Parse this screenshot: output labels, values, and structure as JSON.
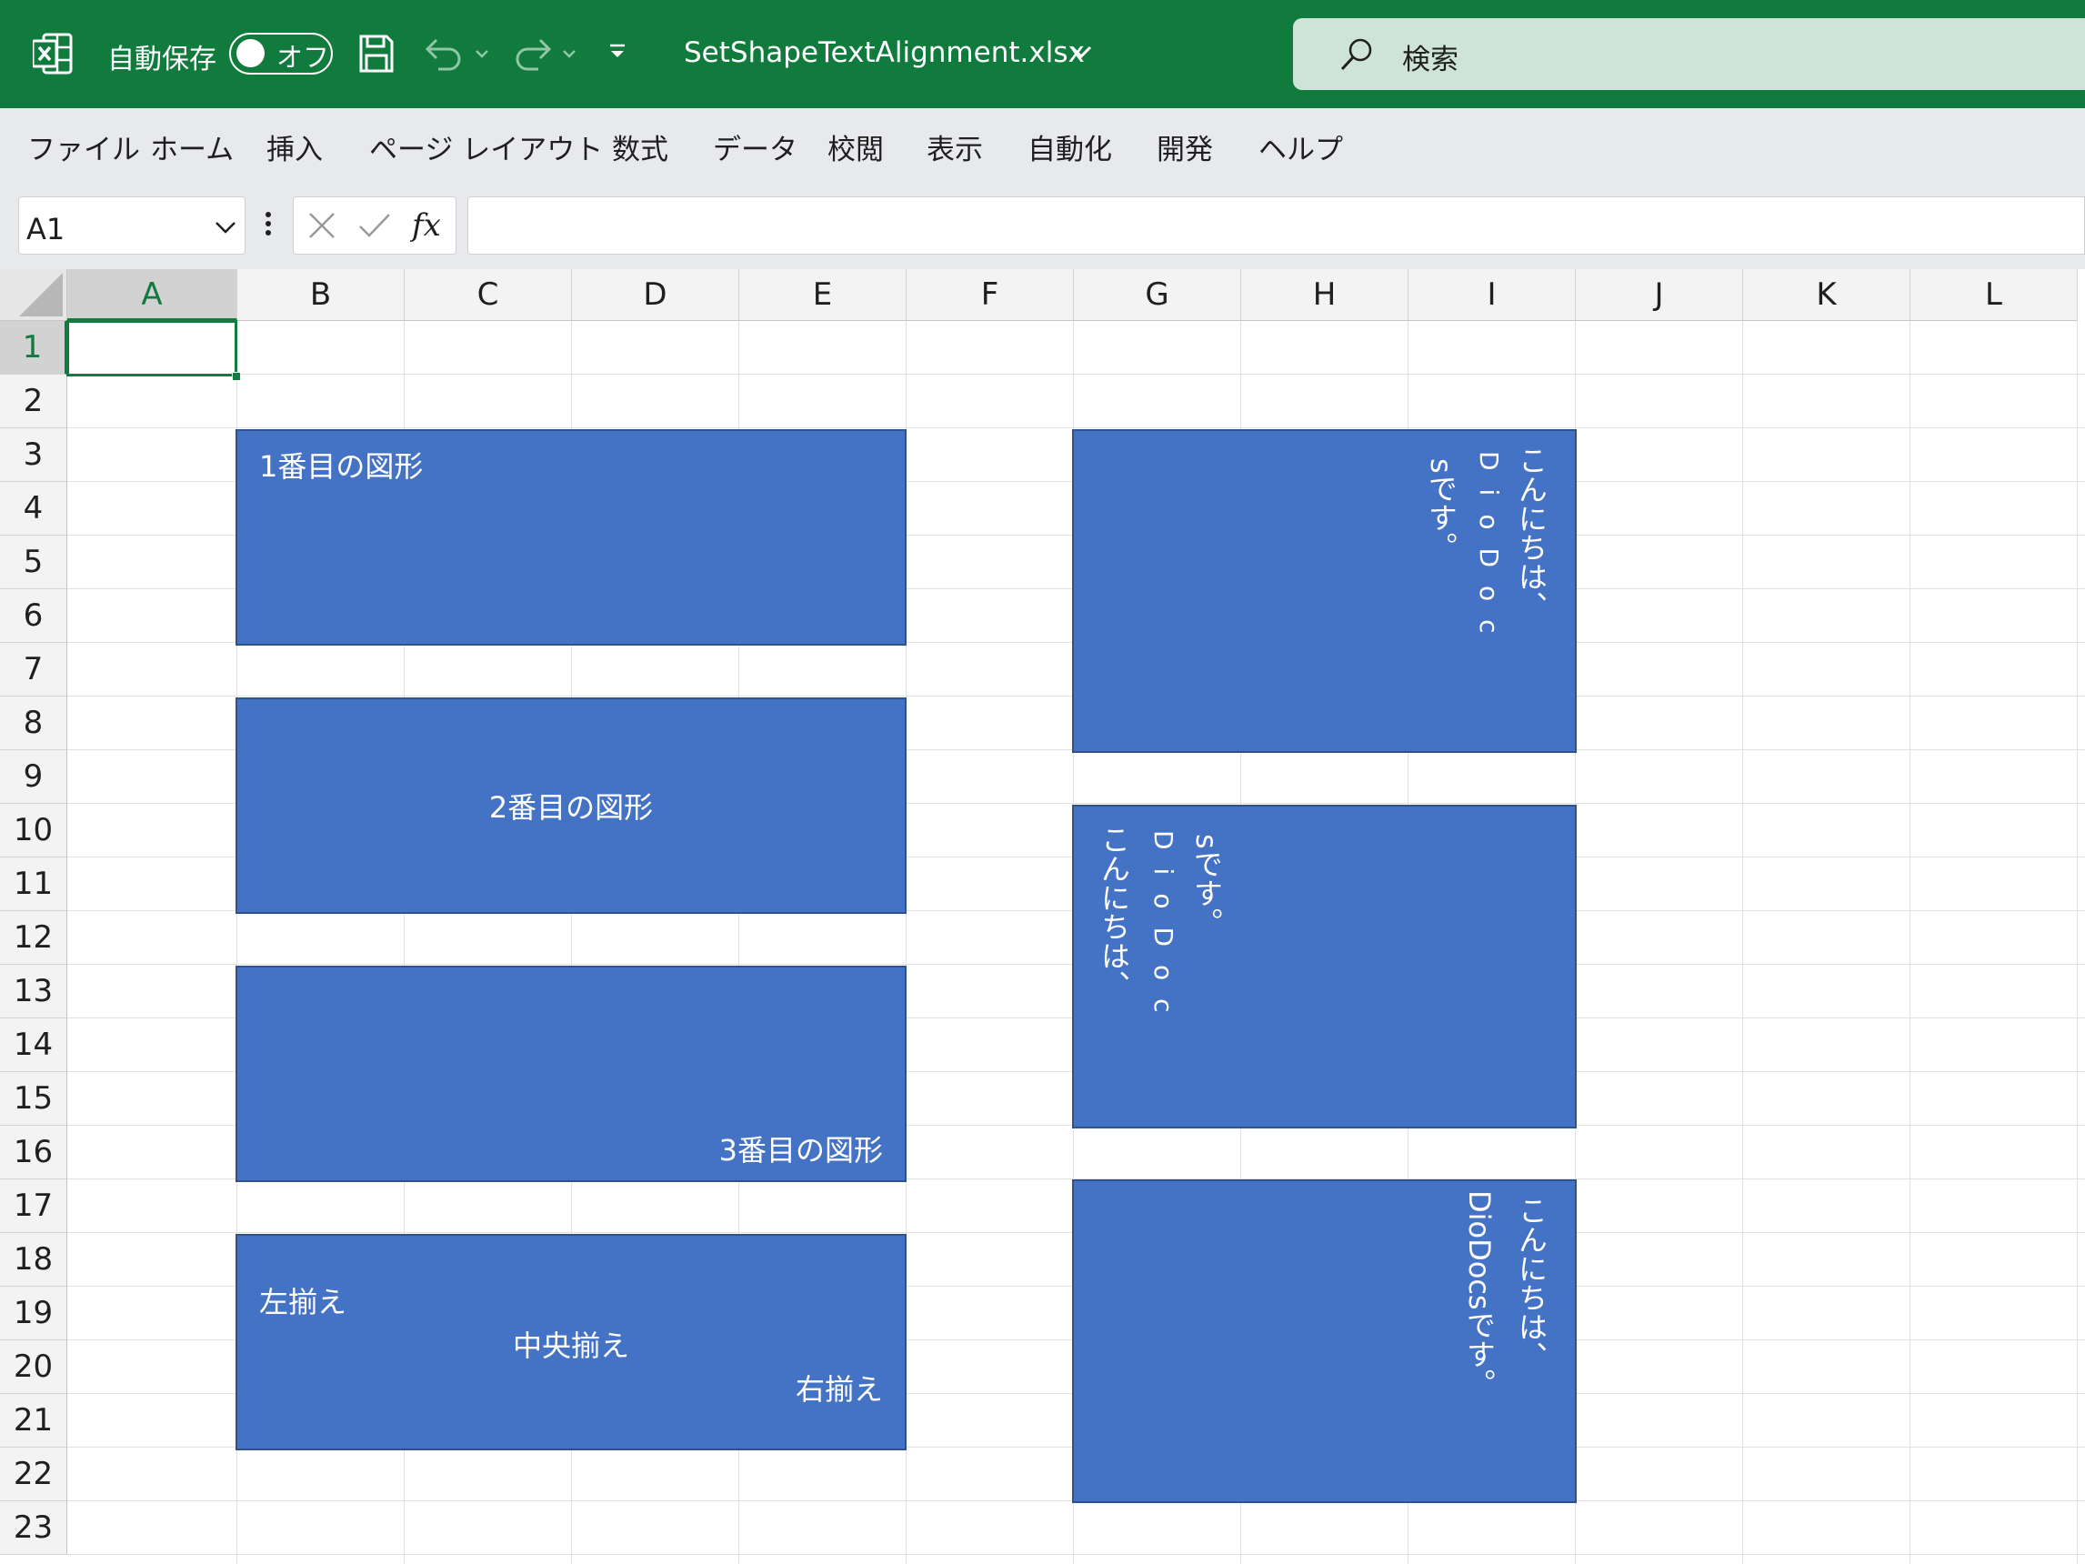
{
  "titlebar": {
    "autosave_label": "自動保存",
    "autosave_state": "オフ",
    "filename": "SetShapeTextAlignment.xlsx",
    "search_placeholder": "検索",
    "bg_color": "#117a3d"
  },
  "menu": [
    "ファイル",
    "ホーム",
    "挿入",
    "ページ レイアウト",
    "数式",
    "データ",
    "校閲",
    "表示",
    "自動化",
    "開発",
    "ヘルプ"
  ],
  "formula_bar": {
    "name_box": "A1",
    "formula": ""
  },
  "columns": [
    "A",
    "B",
    "C",
    "D",
    "E",
    "F",
    "G",
    "H",
    "I",
    "J",
    "K",
    "L"
  ],
  "rows": [
    "1",
    "2",
    "3",
    "4",
    "5",
    "6",
    "7",
    "8",
    "9",
    "10",
    "11",
    "12",
    "13",
    "14",
    "15",
    "16",
    "17",
    "18",
    "19",
    "20",
    "21",
    "22",
    "23"
  ],
  "active_cell": "A1",
  "shapes": {
    "shape1": "1番目の図形",
    "shape2": "2番目の図形",
    "shape3": "3番目の図形",
    "shape4_left": "左揃え",
    "shape4_center": "中央揃え",
    "shape4_right": "右揃え",
    "shape5_col1": "こんにちは、",
    "shape5_col2": "DioDoc",
    "shape5_col3": "sです。",
    "shape6_col1": "こんにちは、",
    "shape6_col2": "DioDoc",
    "shape6_col3": "sです。",
    "shape7_col1": "こんにちは、",
    "shape7_col2": "DioDocsです。",
    "fill_color": "#4472c4"
  }
}
